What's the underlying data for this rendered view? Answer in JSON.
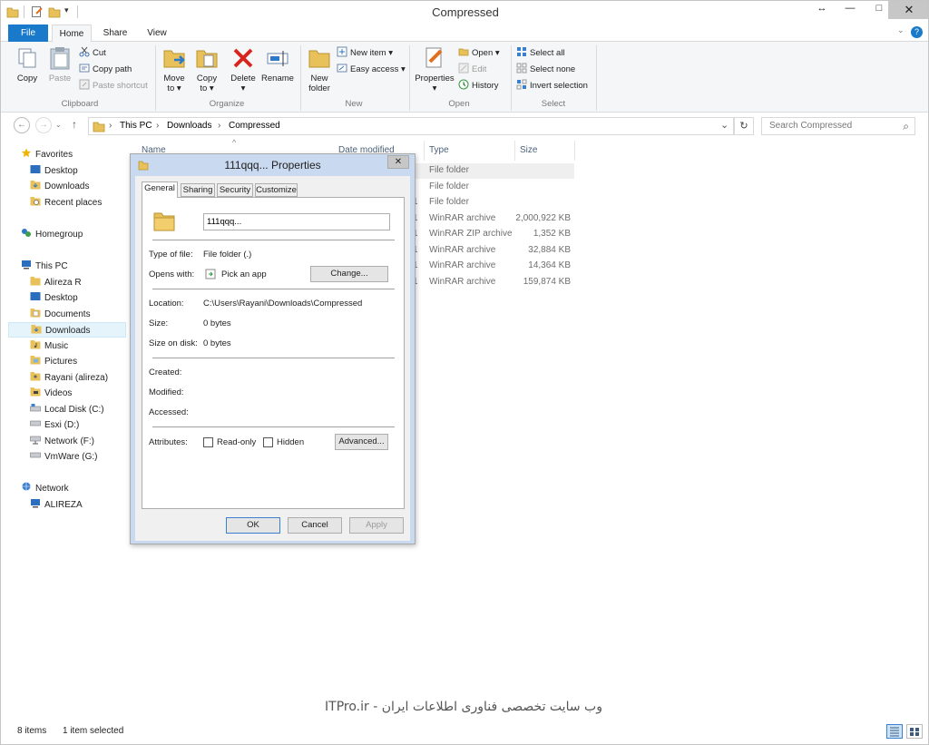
{
  "window": {
    "title": "Compressed",
    "restore_glyph": "↔",
    "minimize_glyph": "—",
    "maximize_glyph": "□",
    "close_glyph": "✕"
  },
  "tabs": [
    "File",
    "Home",
    "Share",
    "View"
  ],
  "help_glyph": "?",
  "ribbon": {
    "clipboard": {
      "copy": "Copy",
      "paste": "Paste",
      "cut": "Cut",
      "copy_path": "Copy path",
      "paste_shortcut": "Paste shortcut",
      "label": "Clipboard"
    },
    "organize": {
      "move_to_1": "Move",
      "move_to_2": "to ▾",
      "copy_to_1": "Copy",
      "copy_to_2": "to ▾",
      "delete_1": "Delete",
      "delete_2": "▾",
      "rename": "Rename",
      "label": "Organize"
    },
    "new": {
      "new_folder_1": "New",
      "new_folder_2": "folder",
      "new_item": "New item ▾",
      "easy_access": "Easy access ▾",
      "label": "New"
    },
    "open": {
      "properties_1": "Properties",
      "properties_2": "▾",
      "open": "Open ▾",
      "edit": "Edit",
      "history": "History",
      "label": "Open"
    },
    "select": {
      "select_all": "Select all",
      "select_none": "Select none",
      "invert": "Invert selection",
      "label": "Select"
    }
  },
  "address": {
    "back": "←",
    "forward": "→",
    "up": "↑",
    "crumbs": [
      "This PC",
      "Downloads",
      "Compressed"
    ],
    "sep": "›",
    "dropdown": "⌄",
    "refresh": "↻",
    "search_placeholder": "Search Compressed",
    "search_glyph": "⌕"
  },
  "nav": {
    "favorites": "Favorites",
    "desktop": "Desktop",
    "downloads": "Downloads",
    "recent": "Recent places",
    "homegroup": "Homegroup",
    "thispc": "This PC",
    "alireza_r": "Alireza R",
    "desktop2": "Desktop",
    "documents": "Documents",
    "downloads2": "Downloads",
    "music": "Music",
    "pictures": "Pictures",
    "rayani": "Rayani (alireza)",
    "videos": "Videos",
    "localdisk": "Local Disk (C:)",
    "esxi": "Esxi (D:)",
    "networkf": "Network (F:)",
    "vmware": "VmWare (G:)",
    "network": "Network",
    "alireza_pc": "ALIREZA"
  },
  "columns": {
    "name": "Name",
    "date": "Date modified",
    "type": "Type",
    "size": "Size",
    "sort_glyph": "^"
  },
  "files": [
    {
      "date": "",
      "type": "File folder",
      "size": ""
    },
    {
      "date": "",
      "type": "File folder",
      "size": ""
    },
    {
      "date": "1",
      "type": "File folder",
      "size": ""
    },
    {
      "date": "1",
      "type": "WinRAR archive",
      "size": "2,000,922 KB"
    },
    {
      "date": "1",
      "type": "WinRAR ZIP archive",
      "size": "1,352 KB"
    },
    {
      "date": "1",
      "type": "WinRAR archive",
      "size": "32,884 KB"
    },
    {
      "date": "1",
      "type": "WinRAR archive",
      "size": "14,364 KB"
    },
    {
      "date": "1",
      "type": "WinRAR archive",
      "size": "159,874 KB"
    }
  ],
  "status": {
    "items": "8 items",
    "selected": "1 item selected"
  },
  "watermark": "ITPro.ir - وب سایت تخصصی فناوری اطلاعات ایران",
  "dialog": {
    "title": "111qqq... Properties",
    "close": "✕",
    "tabs": [
      "General",
      "Sharing",
      "Security",
      "Customize"
    ],
    "name_value": "111qqq...",
    "type_label": "Type of file:",
    "type_value": "File folder (.)",
    "opens_label": "Opens with:",
    "opens_value": "Pick an app",
    "change": "Change...",
    "location_label": "Location:",
    "location_value": "C:\\Users\\Rayani\\Downloads\\Compressed",
    "size_label": "Size:",
    "size_value": "0 bytes",
    "sizeondisk_label": "Size on disk:",
    "sizeondisk_value": "0 bytes",
    "created_label": "Created:",
    "modified_label": "Modified:",
    "accessed_label": "Accessed:",
    "attributes_label": "Attributes:",
    "readonly": "Read-only",
    "hidden": "Hidden",
    "advanced": "Advanced...",
    "ok": "OK",
    "cancel": "Cancel",
    "apply": "Apply"
  },
  "colors": {
    "accent": "#1979ca",
    "folder": "#e8c15a",
    "dialog_frame": "#c9d9ef"
  }
}
